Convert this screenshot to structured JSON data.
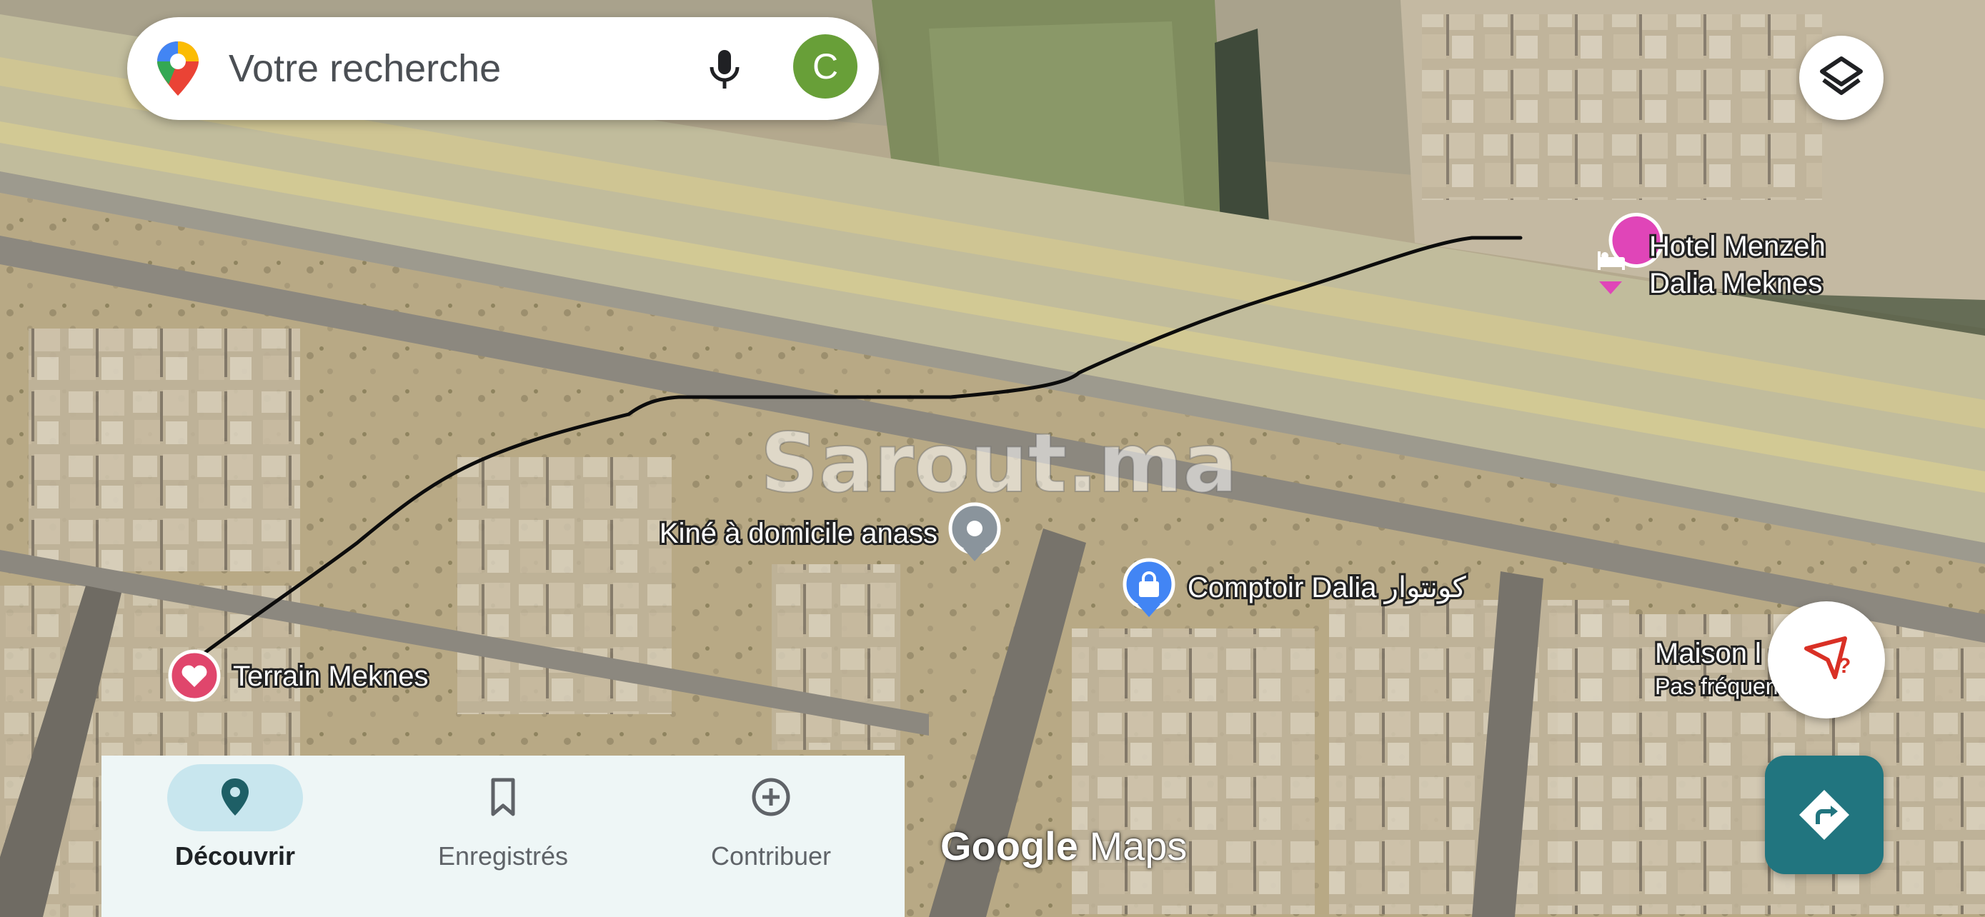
{
  "search": {
    "placeholder": "Votre recherche",
    "avatar_letter": "C",
    "icons": [
      "maps-pin-icon",
      "microphone-icon"
    ]
  },
  "watermark": "Sarout.ma",
  "places": [
    {
      "id": "hotel",
      "line1": "Hotel Menzeh",
      "line2": "Dalia Meknes",
      "icon": "hotel-bed-icon",
      "color": "#e045b8"
    },
    {
      "id": "kine",
      "line1": "Kiné à domicile anass",
      "icon": "place-pin-icon",
      "color": "#8a949c"
    },
    {
      "id": "comptoir",
      "line1": "Comptoir Dalia كونتوار",
      "icon": "shopping-bag-icon",
      "color": "#4285f4"
    },
    {
      "id": "terrain",
      "line1": "Terrain Meknes",
      "icon": "heart-pin-icon",
      "color": "#e0466c"
    },
    {
      "id": "maison",
      "line1": "Maison l",
      "line2": "Pas fréquen",
      "icon": "",
      "color": ""
    }
  ],
  "bottom_nav": [
    {
      "label": "Découvrir",
      "icon": "explore-pin-icon",
      "active": true
    },
    {
      "label": "Enregistrés",
      "icon": "bookmark-icon",
      "active": false
    },
    {
      "label": "Contribuer",
      "icon": "add-circle-icon",
      "active": false
    }
  ],
  "brand": {
    "google": "Google",
    "maps": "Maps"
  },
  "colors": {
    "accent_teal": "#21757f",
    "active_pill": "#c8e6ee",
    "nav_bg": "#eef6f6"
  },
  "fab": {
    "layers_icon": "layers-icon",
    "explore_icon": "explore-nearby-icon",
    "directions_icon": "directions-icon"
  }
}
